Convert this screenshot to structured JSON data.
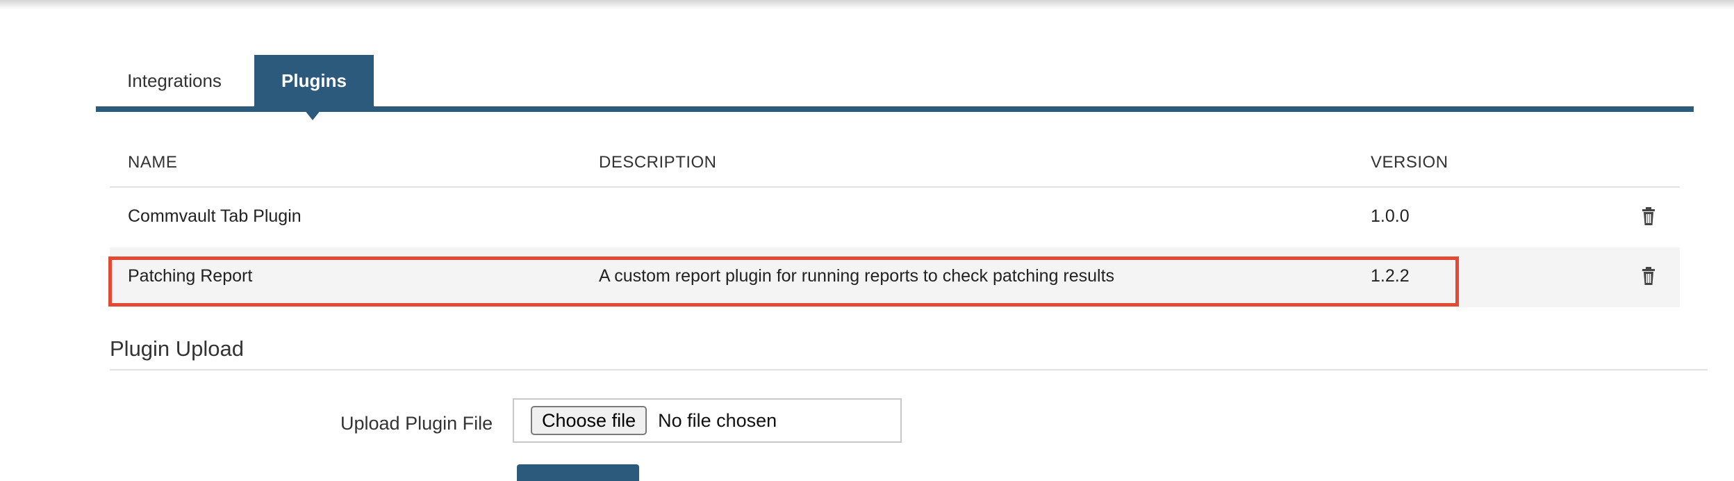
{
  "tabs": [
    {
      "label": "Integrations",
      "active": false
    },
    {
      "label": "Plugins",
      "active": true
    }
  ],
  "table": {
    "headers": {
      "name": "NAME",
      "description": "DESCRIPTION",
      "version": "VERSION"
    },
    "rows": [
      {
        "name": "Commvault Tab Plugin",
        "description": "",
        "version": "1.0.0",
        "action_icon": "trash-icon"
      },
      {
        "name": "Patching Report",
        "description": "A custom report plugin for running reports to check patching results",
        "version": "1.2.2",
        "action_icon": "trash-icon"
      }
    ]
  },
  "upload": {
    "section_title": "Plugin Upload",
    "label": "Upload Plugin File",
    "choose_button": "Choose file",
    "status": "No file chosen"
  },
  "colors": {
    "accent": "#2c5a7c",
    "highlight": "#e24a33",
    "row_stripe": "#f4f4f4"
  }
}
